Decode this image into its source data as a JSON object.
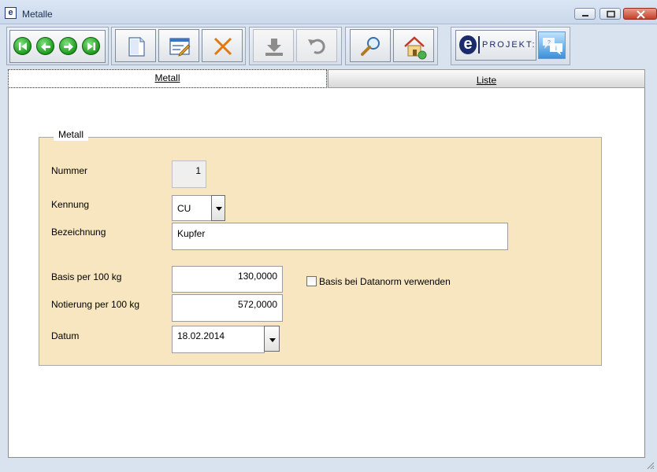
{
  "window": {
    "title": "Metalle",
    "app_icon_letter": "e"
  },
  "toolbar": {
    "nav": [
      "first-record",
      "previous-record",
      "next-record",
      "last-record"
    ],
    "actions": [
      "new-document",
      "edit-form",
      "delete",
      "save",
      "undo",
      "search",
      "home"
    ],
    "brand_letter": "e",
    "brand_text": "PROJEKT:"
  },
  "tabs": [
    {
      "label": "Metall",
      "active": true
    },
    {
      "label": "Liste",
      "active": false
    }
  ],
  "form": {
    "group_title": "Metall",
    "nummer_label": "Nummer",
    "nummer_value": "1",
    "kennung_label": "Kennung",
    "kennung_value": "CU",
    "bezeichnung_label": "Bezeichnung",
    "bezeichnung_value": "Kupfer",
    "basis_label": "Basis per 100 kg",
    "basis_value": "130,0000",
    "notierung_label": "Notierung per 100 kg",
    "notierung_value": "572,0000",
    "datum_label": "Datum",
    "datum_value": "18.02.2014",
    "datanorm_label": "Basis bei Datanorm verwenden",
    "datanorm_checked": false
  }
}
